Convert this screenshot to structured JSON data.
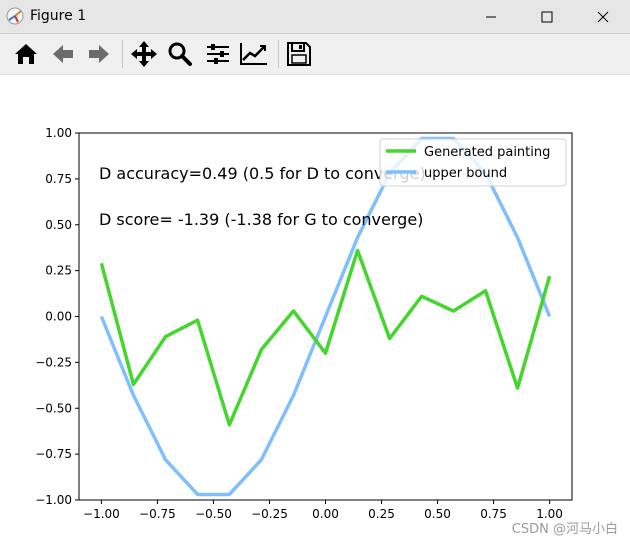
{
  "window": {
    "title": "Figure 1"
  },
  "toolbar": {
    "buttons": [
      {
        "name": "home-icon"
      },
      {
        "name": "back-arrow-icon"
      },
      {
        "name": "forward-arrow-icon"
      },
      {
        "name": "pan-icon"
      },
      {
        "name": "zoom-icon"
      },
      {
        "name": "subplots-config-icon"
      },
      {
        "name": "edit-axis-icon"
      },
      {
        "name": "save-icon"
      }
    ]
  },
  "figure": {
    "annotations": {
      "line1": "D accuracy=0.49 (0.5 for D to converge)",
      "line2": "D score= -1.39 (-1.38 for G to converge)"
    }
  },
  "chart_data": {
    "type": "line",
    "x": [
      -1.0,
      -0.857,
      -0.714,
      -0.571,
      -0.429,
      -0.286,
      -0.143,
      0.0,
      0.143,
      0.286,
      0.429,
      0.571,
      0.714,
      0.857,
      1.0
    ],
    "series": [
      {
        "name": "Generated painting",
        "color": "#44d62c",
        "values": [
          0.29,
          -0.37,
          -0.11,
          -0.02,
          -0.59,
          -0.18,
          0.03,
          -0.2,
          0.36,
          -0.12,
          0.11,
          0.03,
          0.14,
          -0.39,
          0.22
        ]
      },
      {
        "name": "upper bound",
        "color": "#7fbfff",
        "values": [
          0.0,
          -0.43,
          -0.78,
          -0.97,
          -0.97,
          -0.78,
          -0.43,
          0.0,
          0.43,
          0.78,
          0.97,
          0.97,
          0.78,
          0.43,
          0.0
        ]
      }
    ],
    "xlim": [
      -1.1,
      1.1
    ],
    "ylim": [
      -1.0,
      1.0
    ],
    "xticks": [
      "−1.00",
      "−0.75",
      "−0.50",
      "−0.25",
      "0.00",
      "0.25",
      "0.50",
      "0.75",
      "1.00"
    ],
    "xtick_values": [
      -1.0,
      -0.75,
      -0.5,
      -0.25,
      0.0,
      0.25,
      0.5,
      0.75,
      1.0
    ],
    "yticks": [
      "1.00",
      "0.75",
      "0.50",
      "0.25",
      "0.00",
      "−0.25",
      "−0.50",
      "−0.75",
      "−1.00"
    ],
    "ytick_values": [
      1.0,
      0.75,
      0.5,
      0.25,
      0.0,
      -0.25,
      -0.5,
      -0.75,
      -1.0
    ],
    "legend_location": "top-right",
    "grid": false
  },
  "watermark": "CSDN @河马小白"
}
